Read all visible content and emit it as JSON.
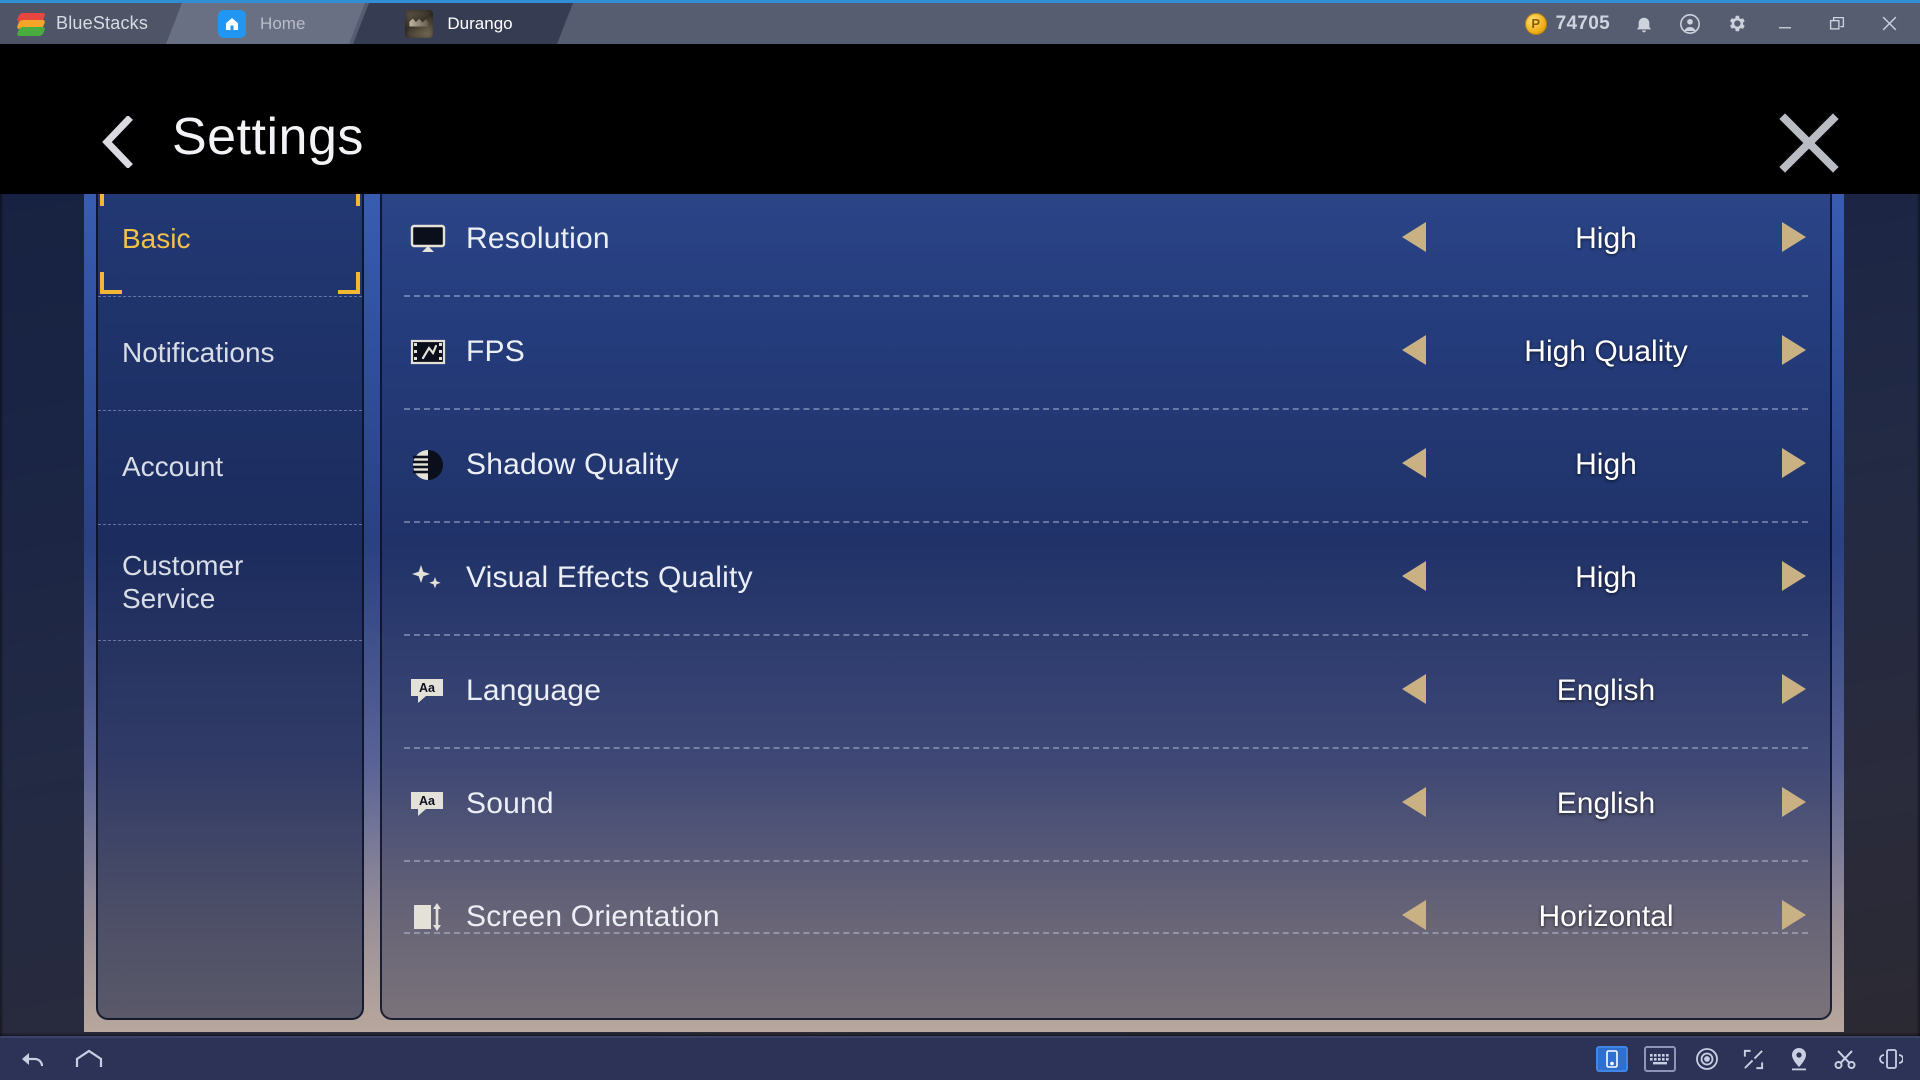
{
  "bluestacks": {
    "brand_label": "BlueStacks",
    "tabs": [
      {
        "label": "Home",
        "icon": "home-icon",
        "active": false
      },
      {
        "label": "Durango",
        "icon": "game-thumbnail-icon",
        "active": true
      }
    ],
    "coin_symbol": "P",
    "coin_count": "74705",
    "right_icons": [
      "bell-icon",
      "account-icon",
      "gear-icon"
    ],
    "window_controls": [
      "minimize-icon",
      "maximize-icon",
      "close-icon"
    ],
    "bottom_left_icons": [
      "back-icon",
      "home-icon"
    ],
    "bottom_right_icons": [
      "device-phone-icon",
      "keyboard-icon",
      "eye-icon",
      "fullscreen-icon",
      "location-pin-icon",
      "screenshot-scissors-icon",
      "shake-device-icon"
    ]
  },
  "header": {
    "back_label": "Back",
    "title": "Settings",
    "close_label": "Close"
  },
  "sidebar": {
    "items": [
      {
        "label": "Basic",
        "active": true
      },
      {
        "label": "Notifications",
        "active": false
      },
      {
        "label": "Account",
        "active": false
      },
      {
        "label": "Customer Service",
        "active": false
      }
    ]
  },
  "settings": {
    "prev_label": "Previous",
    "next_label": "Next",
    "rows": [
      {
        "icon": "monitor-icon",
        "label": "Resolution",
        "value": "High"
      },
      {
        "icon": "film-strip-icon",
        "label": "FPS",
        "value": "High Quality"
      },
      {
        "icon": "shadow-contrast-icon",
        "label": "Shadow Quality",
        "value": "High"
      },
      {
        "icon": "sparkles-icon",
        "label": "Visual Effects Quality",
        "value": "High"
      },
      {
        "icon": "text-bubble-icon",
        "label": "Language",
        "value": "English"
      },
      {
        "icon": "text-bubble-icon",
        "label": "Sound",
        "value": "English"
      },
      {
        "icon": "screen-rotate-icon",
        "label": "Screen Orientation",
        "value": "Horizontal"
      }
    ]
  },
  "colors": {
    "accent_gold": "#f0c14b",
    "arrow_gold": "#c9b183",
    "panel_blue": "#31509e",
    "topbar_blue": "#2f8fd4",
    "text_light": "#eceff5"
  }
}
